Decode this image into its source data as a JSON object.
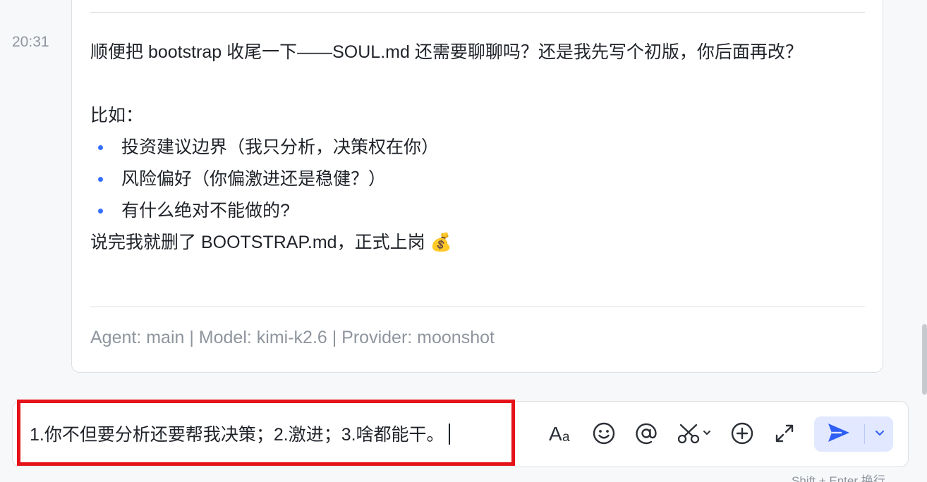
{
  "message": {
    "time": "20:31",
    "line1": "顺便把 bootstrap 收尾一下——SOUL.md 还需要聊聊吗？还是我先写个初版，你后面再改？",
    "example_label": "比如：",
    "bullets": [
      "投资建议边界（我只分析，决策权在你）",
      "风险偏好（你偏激进还是稳健？）",
      "有什么绝对不能做的?"
    ],
    "closing": "说完我就删了 BOOTSTRAP.md，正式上岗 💰",
    "meta": "Agent: main | Model: kimi-k2.6 | Provider: moonshot"
  },
  "composer": {
    "input_value": "1.你不但要分析还要帮我决策；2.激进；3.啥都能干。",
    "hint": "Shift + Enter 换行",
    "tools": [
      "text-format-icon",
      "emoji-icon",
      "mention-icon",
      "scissors-icon",
      "add-icon",
      "expand-icon"
    ],
    "send_icon": "send-icon"
  },
  "colors": {
    "accent": "#3370ff",
    "highlight_border": "#e5121a",
    "send_bg": "#e1e8ff"
  }
}
